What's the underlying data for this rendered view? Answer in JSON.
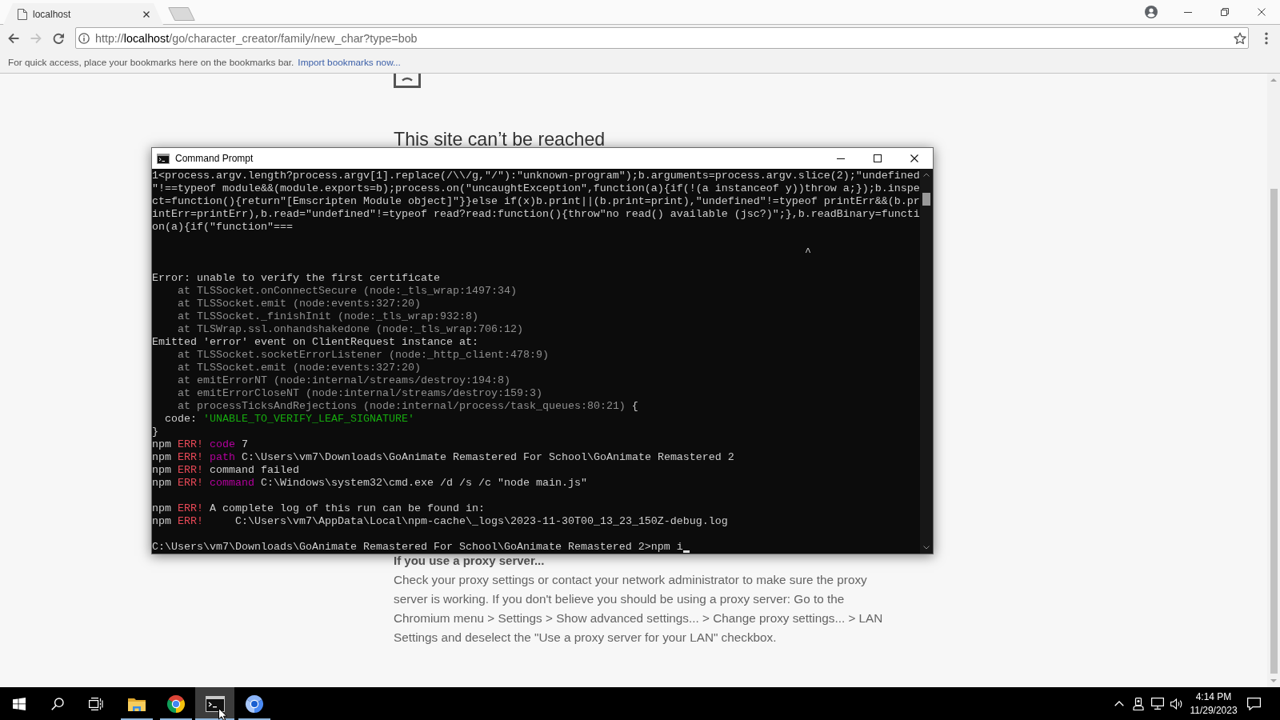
{
  "browser": {
    "tabs": [
      {
        "title": "localhost",
        "selected": true
      }
    ],
    "toolbar": {
      "back": {
        "disabled": false
      },
      "forward": {
        "disabled": true
      }
    },
    "address_bar": {
      "url_parts": [
        {
          "kind": "muted",
          "text": "http://"
        },
        {
          "kind": "host",
          "text": "localhost"
        },
        {
          "kind": "muted",
          "text": "/go/character_creator/family/new_char?type=bob"
        }
      ]
    },
    "bookmarks_bar": {
      "hint": "For quick access, place your bookmarks here on the bookmarks bar.",
      "link": "Import bookmarks now..."
    },
    "page": {
      "heading": "This site can’t be reached",
      "proxy_heading": "If you use a proxy server...",
      "proxy_text": "Check your proxy settings or contact your network administrator to make sure the proxy server is working. If you don't believe you should be using a proxy server: Go to the Chromium menu > Settings > Show advanced settings... > Change proxy settings... > LAN Settings and deselect the \"Use a proxy server for your LAN\" checkbox."
    }
  },
  "console_window": {
    "title": "Command Prompt",
    "lines": [
      {
        "kind": "text",
        "segments": [
          {
            "kind": "plain",
            "text": "1<process.argv.length?process.argv[1].replace(/\\\\/g,\"/\"):\"unknown-program\");b.arguments=process.argv.slice(2);\"undefined"
          }
        ]
      },
      {
        "kind": "text",
        "segments": [
          {
            "kind": "plain",
            "text": "\"!==typeof module&&(module.exports=b);process.on(\"uncaughtException\",function(a){if(!(a instanceof y))throw a;});b.inspe"
          }
        ]
      },
      {
        "kind": "text",
        "segments": [
          {
            "kind": "plain",
            "text": "ct=function(){return\"[Emscripten Module object]\"}}else if(x)b.print||(b.print=print),\"undefined\"!=typeof printErr&&(b.pr"
          }
        ]
      },
      {
        "kind": "text",
        "segments": [
          {
            "kind": "plain",
            "text": "intErr=printErr),b.read=\"undefined\"!=typeof read?read:function(){throw\"no read() available (jsc?)\";},b.readBinary=functi"
          }
        ]
      },
      {
        "kind": "text",
        "segments": [
          {
            "kind": "plain",
            "text": "on(a){if(\"function\"==="
          }
        ]
      },
      {
        "kind": "blank"
      },
      {
        "kind": "text",
        "segments": [
          {
            "kind": "plain",
            "text": "                                                                                                      ^"
          }
        ]
      },
      {
        "kind": "blank"
      },
      {
        "kind": "text",
        "segments": [
          {
            "kind": "plain",
            "text": "Error: unable to verify the first certificate"
          }
        ]
      },
      {
        "kind": "text",
        "segments": [
          {
            "kind": "dim",
            "text": "    at TLSSocket.onConnectSecure (node:_tls_wrap:1497:34)"
          }
        ]
      },
      {
        "kind": "text",
        "segments": [
          {
            "kind": "dim",
            "text": "    at TLSSocket.emit (node:events:327:20)"
          }
        ]
      },
      {
        "kind": "text",
        "segments": [
          {
            "kind": "dim",
            "text": "    at TLSSocket._finishInit (node:_tls_wrap:932:8)"
          }
        ]
      },
      {
        "kind": "text",
        "segments": [
          {
            "kind": "dim",
            "text": "    at TLSWrap.ssl.onhandshakedone (node:_tls_wrap:706:12)"
          }
        ]
      },
      {
        "kind": "text",
        "segments": [
          {
            "kind": "plain",
            "text": "Emitted 'error' event on ClientRequest instance at:"
          }
        ]
      },
      {
        "kind": "text",
        "segments": [
          {
            "kind": "dim",
            "text": "    at TLSSocket.socketErrorListener (node:_http_client:478:9)"
          }
        ]
      },
      {
        "kind": "text",
        "segments": [
          {
            "kind": "dim",
            "text": "    at TLSSocket.emit (node:events:327:20)"
          }
        ]
      },
      {
        "kind": "text",
        "segments": [
          {
            "kind": "dim",
            "text": "    at emitErrorNT (node:internal/streams/destroy:194:8)"
          }
        ]
      },
      {
        "kind": "text",
        "segments": [
          {
            "kind": "dim",
            "text": "    at emitErrorCloseNT (node:internal/streams/destroy:159:3)"
          }
        ]
      },
      {
        "kind": "text",
        "segments": [
          {
            "kind": "dim",
            "text": "    at processTicksAndRejections (node:internal/process/task_queues:80:21)"
          },
          {
            "kind": "plain",
            "text": " {"
          }
        ]
      },
      {
        "kind": "text",
        "segments": [
          {
            "kind": "plain",
            "text": "  code: "
          },
          {
            "kind": "string",
            "text": "'UNABLE_TO_VERIFY_LEAF_SIGNATURE'"
          }
        ]
      },
      {
        "kind": "text",
        "segments": [
          {
            "kind": "plain",
            "text": "}"
          }
        ]
      },
      {
        "kind": "text",
        "segments": [
          {
            "kind": "plain",
            "text": "npm "
          },
          {
            "kind": "error",
            "text": "ERR!"
          },
          {
            "kind": "keyword",
            "text": " code"
          },
          {
            "kind": "plain",
            "text": " 7"
          }
        ]
      },
      {
        "kind": "text",
        "segments": [
          {
            "kind": "plain",
            "text": "npm "
          },
          {
            "kind": "error",
            "text": "ERR!"
          },
          {
            "kind": "keyword",
            "text": " path"
          },
          {
            "kind": "plain",
            "text": " C:\\Users\\vm7\\Downloads\\GoAnimate Remastered For School\\GoAnimate Remastered 2"
          }
        ]
      },
      {
        "kind": "text",
        "segments": [
          {
            "kind": "plain",
            "text": "npm "
          },
          {
            "kind": "error",
            "text": "ERR!"
          },
          {
            "kind": "plain",
            "text": " command failed"
          }
        ]
      },
      {
        "kind": "text",
        "segments": [
          {
            "kind": "plain",
            "text": "npm "
          },
          {
            "kind": "error",
            "text": "ERR!"
          },
          {
            "kind": "keyword",
            "text": " command"
          },
          {
            "kind": "plain",
            "text": " C:\\Windows\\system32\\cmd.exe /d /s /c \"node main.js\""
          }
        ]
      },
      {
        "kind": "blank"
      },
      {
        "kind": "text",
        "segments": [
          {
            "kind": "plain",
            "text": "npm "
          },
          {
            "kind": "error",
            "text": "ERR!"
          },
          {
            "kind": "plain",
            "text": " A complete log of this run can be found in:"
          }
        ]
      },
      {
        "kind": "text",
        "segments": [
          {
            "kind": "plain",
            "text": "npm "
          },
          {
            "kind": "error",
            "text": "ERR!"
          },
          {
            "kind": "plain",
            "text": "     C:\\Users\\vm7\\AppData\\Local\\npm-cache\\_logs\\2023-11-30T00_13_23_150Z-debug.log"
          }
        ]
      },
      {
        "kind": "blank"
      },
      {
        "kind": "text",
        "cursor": true,
        "segments": [
          {
            "kind": "plain",
            "text": "C:\\Users\\vm7\\Downloads\\GoAnimate Remastered For School\\GoAnimate Remastered 2>npm i"
          }
        ]
      }
    ]
  },
  "taskbar": {
    "apps": [
      {
        "running": true,
        "selected": false
      },
      {
        "running": true,
        "selected": false
      },
      {
        "running": true,
        "selected": true
      },
      {
        "running": true,
        "selected": false
      }
    ],
    "time": "4:14 PM",
    "date": "11/29/2023"
  }
}
